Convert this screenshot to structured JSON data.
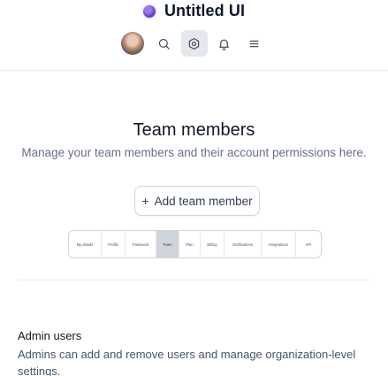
{
  "app": {
    "name": "Untitled UI"
  },
  "header": {
    "icons": [
      "avatar",
      "search-icon",
      "settings-icon",
      "bell-icon",
      "menu-icon"
    ],
    "active_icon": "settings-icon"
  },
  "page": {
    "title": "Team members",
    "subtitle": "Manage your team members and their account permissions here."
  },
  "actions": {
    "add_member_label": "Add team member"
  },
  "tabs": [
    {
      "label": "My details"
    },
    {
      "label": "Profile"
    },
    {
      "label": "Password"
    },
    {
      "label": "Team",
      "active": true
    },
    {
      "label": "Plan"
    },
    {
      "label": "Billing"
    },
    {
      "label": "Notifications"
    },
    {
      "label": "Integrations"
    },
    {
      "label": "API"
    }
  ],
  "section": {
    "title": "Admin users",
    "description": "Admins can add and remove users and manage organization-level settings."
  },
  "colors": {
    "brand": "#6941c6",
    "active_tab_bg": "#d0d5dd",
    "text_primary": "#101828",
    "text_secondary": "#667085"
  }
}
